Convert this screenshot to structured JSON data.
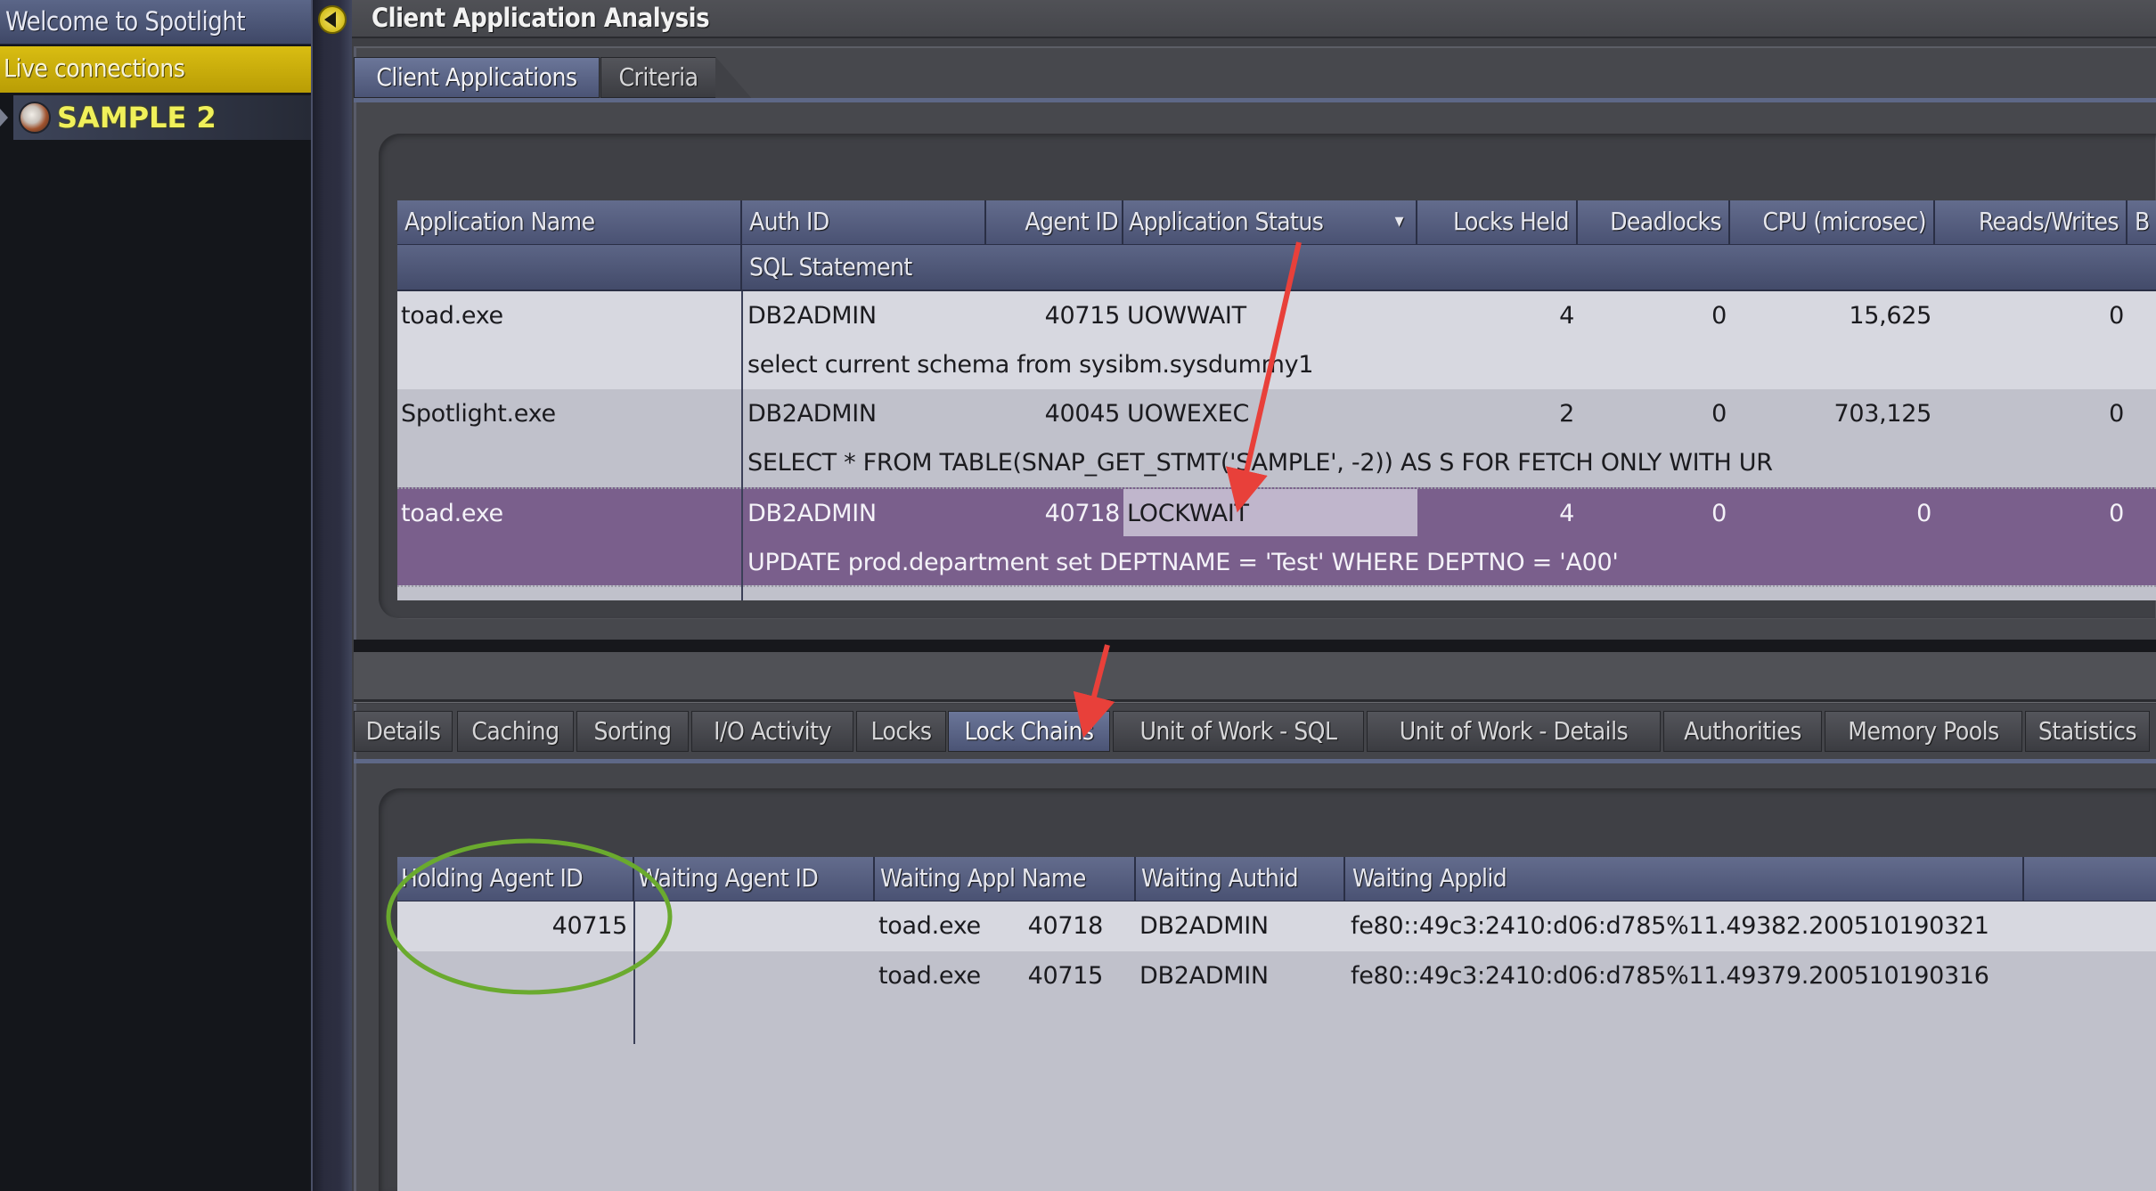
{
  "sidebar": {
    "welcome_label": "Welcome to Spotlight",
    "live_connections_label": "Live connections",
    "connections": [
      {
        "name": "SAMPLE 2",
        "icon": "database-connection-icon"
      }
    ]
  },
  "header": {
    "title": "Client Application Analysis",
    "collapse_icon": "chevron-left-icon"
  },
  "upper_tabs": [
    {
      "label": "Client Applications",
      "active": true
    },
    {
      "label": "Criteria",
      "active": false
    }
  ],
  "app_grid": {
    "columns": [
      "Application Name",
      "Auth ID",
      "Agent ID",
      "Application Status",
      "Locks Held",
      "Deadlocks",
      "CPU (microsec)",
      "Reads/Writes",
      "B"
    ],
    "sort_indicator": "▾",
    "sub_header": "SQL Statement",
    "rows": [
      {
        "application_name": "toad.exe",
        "auth_id": "DB2ADMIN",
        "agent_id": "40715",
        "status": "UOWWAIT",
        "locks_held": "4",
        "deadlocks": "0",
        "cpu": "15,625",
        "reads_writes": "0",
        "sql": "select current schema from sysibm.sysdummy1",
        "selected": false
      },
      {
        "application_name": "Spotlight.exe",
        "auth_id": "DB2ADMIN",
        "agent_id": "40045",
        "status": "UOWEXEC",
        "locks_held": "2",
        "deadlocks": "0",
        "cpu": "703,125",
        "reads_writes": "0",
        "sql": "SELECT * FROM TABLE(SNAP_GET_STMT('SAMPLE', -2)) AS S FOR FETCH ONLY WITH UR",
        "selected": false
      },
      {
        "application_name": "toad.exe",
        "auth_id": "DB2ADMIN",
        "agent_id": "40718",
        "status": "LOCKWAIT",
        "locks_held": "4",
        "deadlocks": "0",
        "cpu": "0",
        "reads_writes": "0",
        "sql": "UPDATE prod.department set DEPTNAME = 'Test' WHERE DEPTNO = 'A00'",
        "selected": true
      }
    ]
  },
  "lower_tabs": [
    {
      "label": "Details",
      "active": false
    },
    {
      "label": "Caching",
      "active": false
    },
    {
      "label": "Sorting",
      "active": false
    },
    {
      "label": "I/O Activity",
      "active": false
    },
    {
      "label": "Locks",
      "active": false
    },
    {
      "label": "Lock Chains",
      "active": true
    },
    {
      "label": "Unit of Work - SQL",
      "active": false
    },
    {
      "label": "Unit of Work - Details",
      "active": false
    },
    {
      "label": "Authorities",
      "active": false
    },
    {
      "label": "Memory Pools",
      "active": false
    },
    {
      "label": "Statistics",
      "active": false
    }
  ],
  "lock_chains": {
    "columns": [
      "Holding Agent ID",
      "Waiting Agent ID",
      "Waiting Appl Name",
      "Waiting Authid",
      "Waiting Applid"
    ],
    "rows": [
      {
        "holding_agent_id": "40715",
        "waiting_agent_id": "40718",
        "waiting_appl_name": "toad.exe",
        "waiting_authid": "DB2ADMIN",
        "waiting_applid": "fe80::49c3:2410:d06:d785%11.49382.200510190321"
      },
      {
        "holding_agent_id": "",
        "waiting_agent_id": "40715",
        "waiting_appl_name": "toad.exe",
        "waiting_authid": "DB2ADMIN",
        "waiting_applid": "fe80::49c3:2410:d06:d785%11.49379.200510190316"
      }
    ]
  },
  "annotations": {
    "arrow_color": "#e8403a",
    "circle_color": "#6aaa2e"
  },
  "colors": {
    "selected_row": "#7a5f8c",
    "highlight_cell": "#c0b6cc",
    "row_light": "#d7d8e0",
    "row_dark": "#c0c1cb",
    "header": "#4f5878",
    "live_connections": "#c9ad0a",
    "connection_label": "#f0f05a"
  }
}
